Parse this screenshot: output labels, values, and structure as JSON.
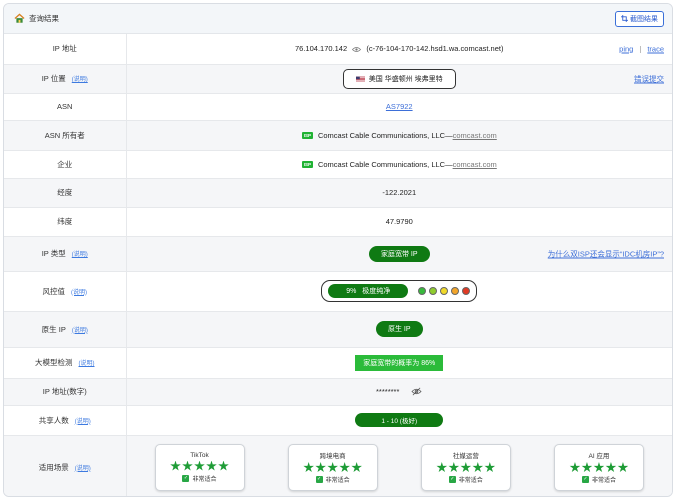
{
  "header": {
    "title": "查询结果",
    "screenshot_button": "截图结果"
  },
  "explain_label": "(说明)",
  "rows": {
    "ip": {
      "label": "IP 地址",
      "value": "76.104.170.142",
      "host": "(c-76-104-170-142.hsd1.wa.comcast.net)",
      "links": [
        "ping",
        "trace"
      ]
    },
    "location": {
      "label": "IP 位置",
      "value": "美国 华盛顿州 埃弗里特",
      "report_link": "错误提交"
    },
    "asn": {
      "label": "ASN",
      "value": "AS7922"
    },
    "asn_owner": {
      "label": "ASN 所有者",
      "badge": "ISP",
      "value": "Comcast Cable Communications, LLC—",
      "domain": "comcast.com"
    },
    "company": {
      "label": "企业",
      "badge": "ISP",
      "value": "Comcast Cable Communications, LLC—",
      "domain": "comcast.com"
    },
    "longitude": {
      "label": "经度",
      "value": "-122.2021"
    },
    "latitude": {
      "label": "纬度",
      "value": "47.9790"
    },
    "ip_type": {
      "label": "IP 类型",
      "value": "家庭宽带 IP",
      "question_link": "为什么双ISP还会显示“IDC机房IP”?"
    },
    "risk": {
      "label": "风控值",
      "score": "9%",
      "level": "极度纯净",
      "dot_colors": [
        "#38b93c",
        "#8fcc2e",
        "#f0d92a",
        "#f2a52a",
        "#e03a24"
      ]
    },
    "native_ip": {
      "label": "原生 IP",
      "value": "原生 IP"
    },
    "ai_detect": {
      "label": "大模型检测",
      "value": "家庭宽带的概率为 86%"
    },
    "ip_numeric": {
      "label": "IP 地址(数字)",
      "value": "********"
    },
    "shared": {
      "label": "共享人数",
      "value": "1 - 10 (极好)"
    },
    "scenes": {
      "label": "适用场景",
      "items": [
        {
          "name": "TikTok",
          "rating": 5,
          "suit": "非常适合"
        },
        {
          "name": "跨境电商",
          "rating": 5,
          "suit": "非常适合"
        },
        {
          "name": "社媒运营",
          "rating": 5,
          "suit": "非常适合"
        },
        {
          "name": "AI 应用",
          "rating": 5,
          "suit": "非常适合"
        }
      ]
    }
  },
  "colors": {
    "accent_green": "#0f7a13",
    "link_blue": "#3d6fd8",
    "star_green": "#1e9c36"
  }
}
